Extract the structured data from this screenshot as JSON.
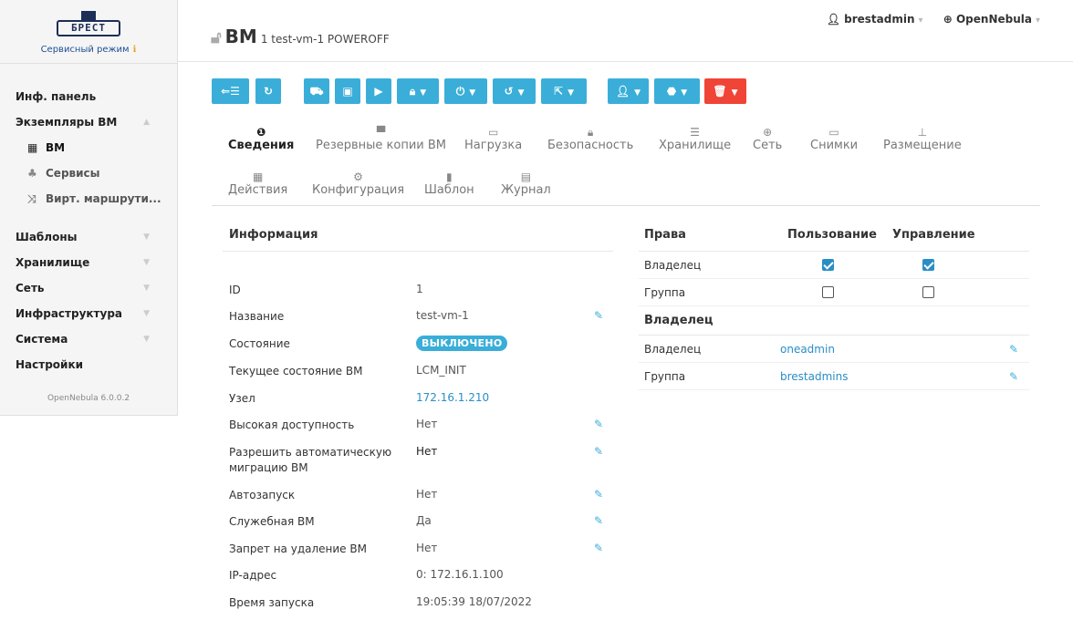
{
  "brand": {
    "logo_text": "БРЕСТ",
    "service_mode": "Сервисный режим",
    "version": "OpenNebula 6.0.0.2"
  },
  "sidebar": {
    "dashboard": "Инф. панель",
    "vm_instances": "Экземпляры ВМ",
    "vms": "ВМ",
    "services": "Сервисы",
    "vrouters": "Вирт. маршрути...",
    "templates": "Шаблоны",
    "storage": "Хранилище",
    "network": "Сеть",
    "infrastructure": "Инфраструктура",
    "system": "Система",
    "settings": "Настройки"
  },
  "header": {
    "title": "ВМ",
    "subtitle": "1 test-vm-1 POWEROFF",
    "user": "brestadmin",
    "zone": "OpenNebula"
  },
  "tabs": [
    {
      "label": "Сведения",
      "icon": "info-icon"
    },
    {
      "label": "Резервные копии ВМ",
      "icon": "archive-icon"
    },
    {
      "label": "Нагрузка",
      "icon": "laptop-icon"
    },
    {
      "label": "Безопасность",
      "icon": "lock-icon"
    },
    {
      "label": "Хранилище",
      "icon": "database-icon"
    },
    {
      "label": "Сеть",
      "icon": "globe-icon"
    },
    {
      "label": "Снимки",
      "icon": "laptop-icon"
    },
    {
      "label": "Размещение",
      "icon": "sitemap-icon"
    },
    {
      "label": "Действия",
      "icon": "calendar-icon"
    },
    {
      "label": "Конфигурация",
      "icon": "cog-icon"
    },
    {
      "label": "Шаблон",
      "icon": "file-icon"
    },
    {
      "label": "Журнал",
      "icon": "file-text-icon"
    }
  ],
  "info": {
    "header": "Информация",
    "rows": [
      {
        "key": "ID",
        "value": "1"
      },
      {
        "key": "Название",
        "value": "test-vm-1"
      },
      {
        "key": "Состояние",
        "value": "ВЫКЛЮЧЕНО"
      },
      {
        "key": "Текущее состояние ВМ",
        "value": "LCM_INIT"
      },
      {
        "key": "Узел",
        "value": "172.16.1.210"
      },
      {
        "key": "Высокая доступность",
        "value": "Нет"
      },
      {
        "key": "Разрешить автоматическую миграцию ВМ",
        "value": "Нет"
      },
      {
        "key": "Автозапуск",
        "value": "Нет"
      },
      {
        "key": "Служебная ВМ",
        "value": "Да"
      },
      {
        "key": "Запрет на удаление ВМ",
        "value": "Нет"
      },
      {
        "key": "IP-адрес",
        "value": "0: 172.16.1.100"
      },
      {
        "key": "Время запуска",
        "value": "19:05:39 18/07/2022"
      }
    ]
  },
  "permissions": {
    "header_rights": "Права",
    "header_use": "Пользование",
    "header_manage": "Управление",
    "rows": [
      {
        "label": "Владелец",
        "use": true,
        "manage": true
      },
      {
        "label": "Группа",
        "use": false,
        "manage": false
      }
    ]
  },
  "ownership": {
    "header": "Владелец",
    "owner_label": "Владелец",
    "owner_value": "oneadmin",
    "group_label": "Группа",
    "group_value": "brestadmins"
  },
  "colors": {
    "accent": "#3aaed8",
    "danger": "#f04437",
    "link": "#2a8ec6"
  }
}
